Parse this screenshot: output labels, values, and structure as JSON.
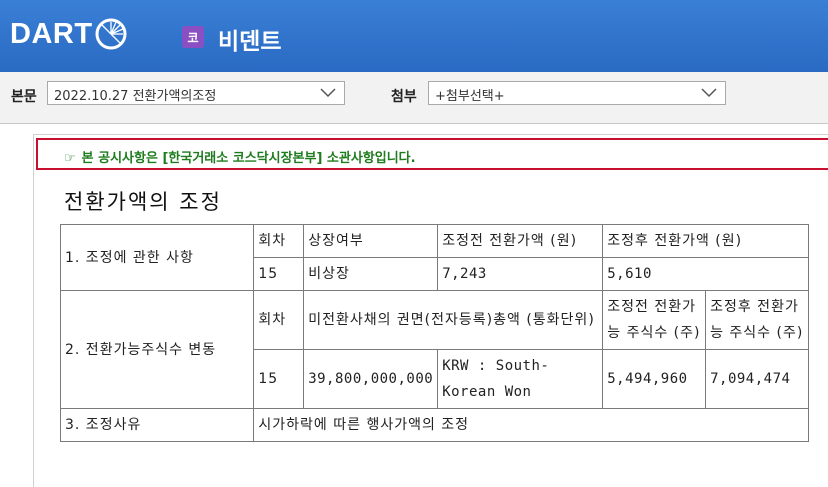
{
  "header": {
    "logo_text": "DART",
    "company_badge": "코",
    "company_name": "비덴트"
  },
  "selectors": {
    "body_label": "본문",
    "body_value": "2022.10.27  전환가액의조정",
    "attach_label": "첨부",
    "attach_value": "+첨부선택+"
  },
  "notice": {
    "text": "본 공시사항은 [한국거래소 코스닥시장본부] 소관사항입니다."
  },
  "document": {
    "title": "전환가액의 조정",
    "row1": {
      "label": "1. 조정에 관한 사항",
      "headers": [
        "회차",
        "상장여부",
        "조정전 전환가액 (원)",
        "조정후 전환가액 (원)"
      ],
      "values": [
        "15",
        "비상장",
        "7,243",
        "5,610"
      ]
    },
    "row2": {
      "label": "2. 전환가능주식수 변동",
      "headers": [
        "회차",
        "미전환사채의 권면(전자등록)총액 (통화단위)",
        "조정전 전환가능 주식수 (주)",
        "조정후 전환가능 주식수 (주)"
      ],
      "values": [
        "15",
        "39,800,000,000",
        "KRW : South-Korean Won",
        "5,494,960",
        "7,094,474"
      ]
    },
    "row3": {
      "label": "3. 조정사유",
      "value": "시가하락에 따른 행사가액의 조정"
    }
  }
}
